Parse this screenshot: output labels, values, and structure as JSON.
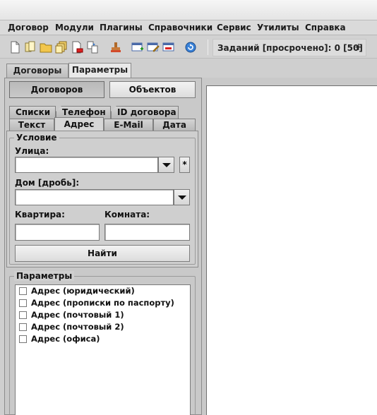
{
  "menu": [
    "Договор",
    "Модули",
    "Плагины",
    "Справочники",
    "Сервис",
    "Утилиты",
    "Справка"
  ],
  "toolbar": {
    "icons": [
      "new-document-icon",
      "copy-document-icon",
      "open-folder-icon",
      "documents-icon",
      "delete-document-icon",
      "move-document-icon",
      "stamp-icon",
      "add-window-icon",
      "edit-window-icon",
      "remove-window-icon",
      "refresh-icon"
    ],
    "tasks_label": "Заданий [просрочено]: 0 [50]",
    "tasks_add": "+"
  },
  "main_tabs": [
    {
      "label": "Договоры",
      "active": false
    },
    {
      "label": "Параметры",
      "active": true
    }
  ],
  "mode_buttons": {
    "contracts": "Договоров",
    "objects": "Объектов",
    "selected": "contracts"
  },
  "search_tabs": {
    "row_back": [
      "Списки",
      "Телефон",
      "ID договора"
    ],
    "row_front": [
      "Текст",
      "Адрес",
      "E-Mail",
      "Дата"
    ],
    "active": "Адрес"
  },
  "condition": {
    "group_title": "Условие",
    "street_label": "Улица:",
    "street_value": "",
    "star_label": "*",
    "house_label": "Дом [дробь]:",
    "house_value": "",
    "apartment_label": "Квартира:",
    "apartment_value": "",
    "room_label": "Комната:",
    "room_value": "",
    "find_button": "Найти"
  },
  "parameters": {
    "group_title": "Параметры",
    "items": [
      {
        "label": "Адрес (юридический)",
        "checked": false
      },
      {
        "label": "Адрес (прописки по паспорту)",
        "checked": false
      },
      {
        "label": "Адрес (почтовый 1)",
        "checked": false
      },
      {
        "label": "Адрес (почтовый 2)",
        "checked": false
      },
      {
        "label": "Адрес (офиса)",
        "checked": false
      }
    ]
  }
}
